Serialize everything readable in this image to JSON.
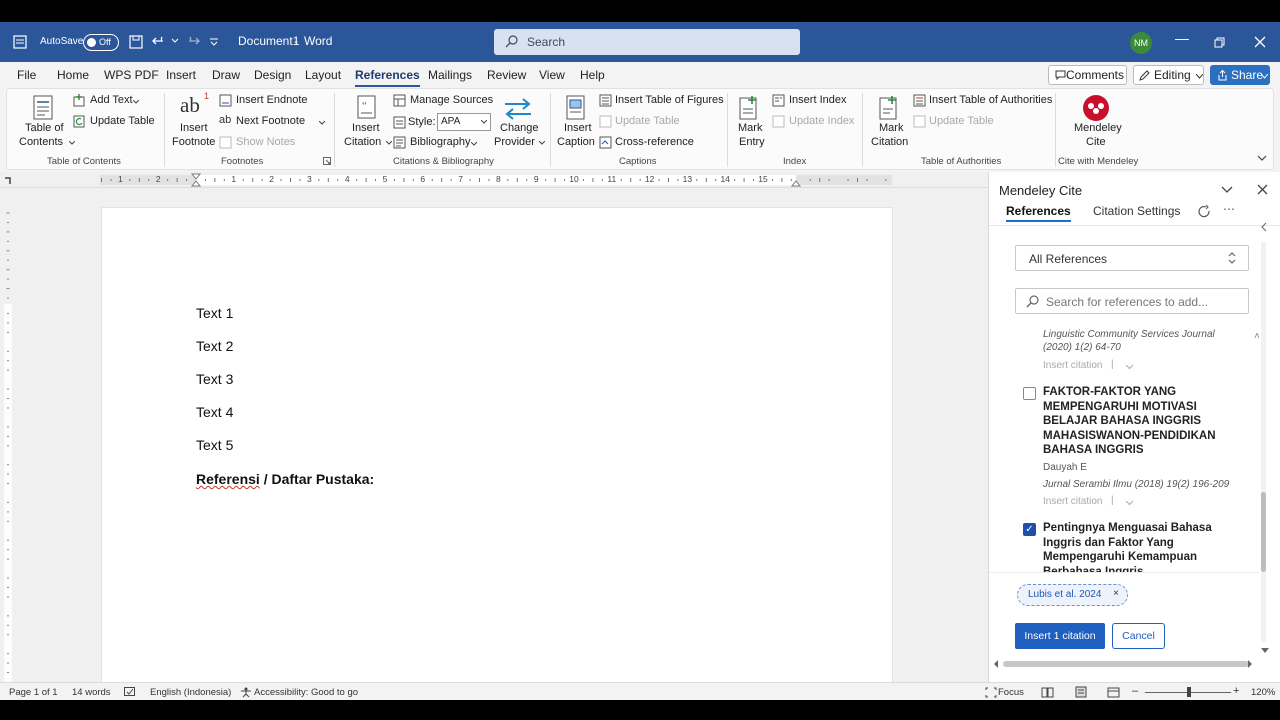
{
  "title_bar": {
    "autosave_label": "AutoSave",
    "autosave_state": "Off",
    "doc_title": "Document1",
    "app_sep": "-",
    "app_name": "Word",
    "search_placeholder": "Search",
    "user_initials": "NM",
    "accent": "#2b579a"
  },
  "tabs": [
    "File",
    "Home",
    "WPS PDF",
    "Insert",
    "Draw",
    "Design",
    "Layout",
    "References",
    "Mailings",
    "Review",
    "View",
    "Help"
  ],
  "active_tab": "References",
  "right_buttons": {
    "comments": "Comments",
    "editing": "Editing",
    "share": "Share"
  },
  "ribbon": {
    "toc": {
      "line1": "Table of",
      "line2": "Contents",
      "add_text": "Add Text",
      "update_table": "Update Table",
      "group": "Table of Contents"
    },
    "footnotes": {
      "line1": "Insert",
      "line2": "Footnote",
      "insert_endnote": "Insert Endnote",
      "next_footnote": "Next Footnote",
      "show_notes": "Show Notes",
      "group": "Footnotes"
    },
    "citations": {
      "line1": "Insert",
      "line2": "Citation",
      "manage_sources": "Manage Sources",
      "style_label": "Style:",
      "style_value": "APA",
      "bibliography": "Bibliography",
      "change1": "Change",
      "change2": "Provider",
      "group": "Citations & Bibliography"
    },
    "captions": {
      "line1": "Insert",
      "line2": "Caption",
      "insert_tof": "Insert Table of Figures",
      "update_table": "Update Table",
      "cross_ref": "Cross-reference",
      "group": "Captions"
    },
    "index": {
      "line1": "Mark",
      "line2": "Entry",
      "insert_index": "Insert Index",
      "update_index": "Update Index",
      "group": "Index"
    },
    "toa": {
      "line1": "Mark",
      "line2": "Citation",
      "insert_toa": "Insert Table of Authorities",
      "update_table": "Update Table",
      "group": "Table of Authorities"
    },
    "mendeley": {
      "line1": "Mendeley",
      "line2": "Cite",
      "group": "Cite with Mendeley"
    }
  },
  "ruler_numbers": [
    "1",
    "2",
    "1",
    "1",
    "1",
    "2",
    "3",
    "4",
    "5",
    "6",
    "7",
    "8",
    "9",
    "10",
    "11",
    "12",
    "13",
    "14",
    "15"
  ],
  "document": {
    "lines": [
      "Text 1",
      "Text 2",
      "Text 3",
      "Text 4",
      "Text 5"
    ],
    "heading_part1": "Referensi",
    "heading_part2": " / Daftar Pustaka:"
  },
  "mendeley": {
    "pane_title": "Mendeley Cite",
    "tab_references": "References",
    "tab_settings": "Citation Settings",
    "dropdown_value": "All References",
    "search_placeholder": "Search for references to add...",
    "ref0_journal": "Linguistic Community Services Journal (2020) 1(2) 64-70",
    "insert_citation": "Insert citation",
    "ref1_title": "FAKTOR-FAKTOR YANG MEMPENGARUHI MOTIVASI BELAJAR BAHASA INGGRIS MAHASISWANON-PENDIDIKAN BAHASA INGGRIS",
    "ref1_author": "Dauyah E",
    "ref1_journal": "Jurnal Serambi Ilmu (2018) 19(2) 196-209",
    "ref2_title": "Pentingnya Menguasai Bahasa Inggris dan Faktor Yang Mempengaruhi Kemampuan Berbahasa Inggris",
    "ref1_checked": false,
    "ref2_checked": true,
    "chip_label": "Lubis et al. 2024",
    "chip_remove": "×",
    "insert_button": "Insert 1 citation",
    "cancel_button": "Cancel"
  },
  "status_bar": {
    "page": "Page 1 of 1",
    "words": "14 words",
    "language": "English (Indonesia)",
    "accessibility": "Accessibility: Good to go",
    "focus": "Focus",
    "zoom": "120%"
  }
}
